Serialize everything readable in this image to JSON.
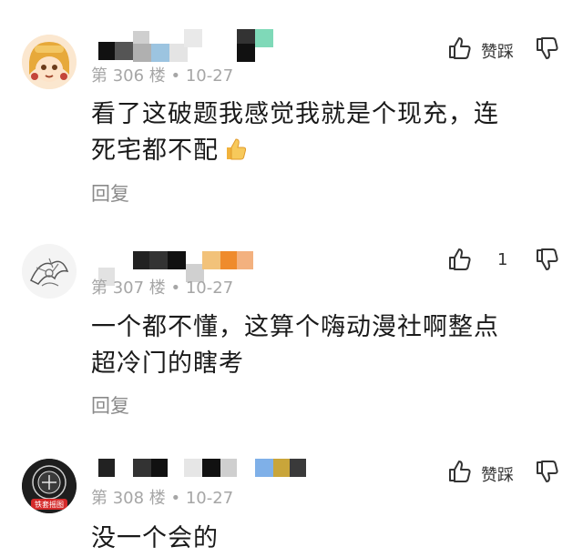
{
  "colors": {
    "meta": "#a6a6a6",
    "text": "#1a1a1a",
    "reply": "#8a8a8a"
  },
  "comments": [
    {
      "floor_label": "第 306 楼 • 10-27",
      "content_line1": "看了这破题我感觉我就是个现充，连",
      "content_line2": "死宅都不配",
      "emoji": "thumbs-up-emoji",
      "reply_label": "回复",
      "like_icon": "thumbs-up-icon",
      "like_count": "",
      "dislike_label": "赞踩",
      "dislike_icon": "thumbs-down-icon",
      "avatar": "anime-girl-avatar"
    },
    {
      "floor_label": "第 307 楼 • 10-27",
      "content_line1": "一个都不懂，这算个嗨动漫社啊整点",
      "content_line2": "超冷门的瞎考",
      "reply_label": "回复",
      "like_icon": "thumbs-up-icon",
      "like_count": "1",
      "dislike_label": "",
      "dislike_icon": "thumbs-down-icon",
      "avatar": "sketch-avatar"
    },
    {
      "floor_label": "第 308 楼 • 10-27",
      "content_line1": "没一个会的",
      "like_icon": "thumbs-up-icon",
      "like_count": "",
      "dislike_label": "赞踩",
      "dislike_icon": "thumbs-down-icon",
      "avatar": "emblem-avatar",
      "avatar_badge": "铁套摇图"
    }
  ]
}
